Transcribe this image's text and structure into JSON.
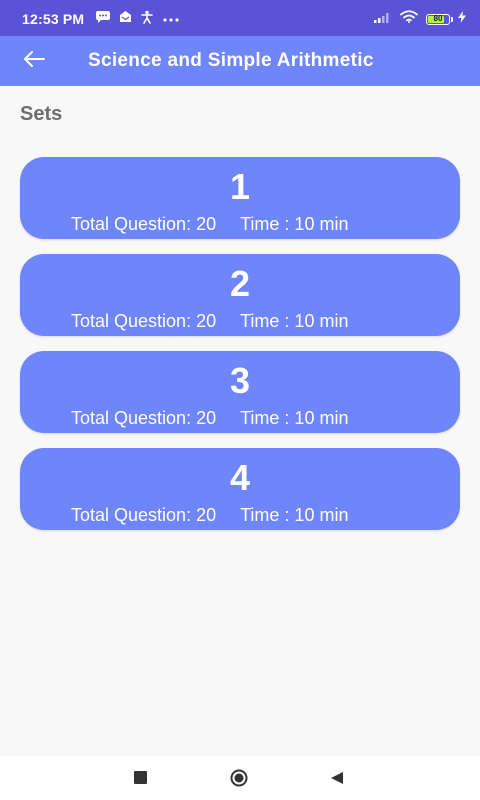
{
  "status_bar": {
    "time": "12:53 PM",
    "left_icons": [
      "chat-icon",
      "notification-icon",
      "accessibility-icon",
      "more-icon"
    ],
    "battery_level": 80,
    "battery_text": "80",
    "colors": {
      "background": "#5b53d6",
      "battery_fill": "#b6f34c"
    }
  },
  "app_bar": {
    "title": "Science and Simple Arithmetic",
    "back_icon": "arrow-left-icon",
    "color": "#6f85fb"
  },
  "section_title": "Sets",
  "sets": [
    {
      "number": "1",
      "total_label": "Total Question: 20",
      "time_label": "Time : 10 min"
    },
    {
      "number": "2",
      "total_label": "Total Question: 20",
      "time_label": "Time : 10 min"
    },
    {
      "number": "3",
      "total_label": "Total Question: 20",
      "time_label": "Time : 10 min"
    },
    {
      "number": "4",
      "total_label": "Total Question: 20",
      "time_label": "Time : 10 min"
    }
  ],
  "colors": {
    "card": "#6f85fb",
    "page_background": "#f8f8f8",
    "section_text": "#6e6e6e"
  },
  "nav_bar": {
    "icons": [
      "recents-icon",
      "home-icon",
      "back-icon"
    ]
  }
}
